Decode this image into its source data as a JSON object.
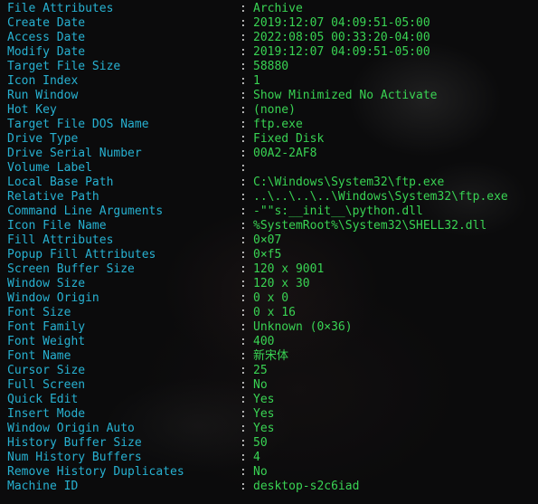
{
  "terminal": {
    "separator": ":",
    "rows": [
      {
        "key": "File Attributes",
        "value": "Archive"
      },
      {
        "key": "Create Date",
        "value": "2019:12:07 04:09:51-05:00"
      },
      {
        "key": "Access Date",
        "value": "2022:08:05 00:33:20-04:00"
      },
      {
        "key": "Modify Date",
        "value": "2019:12:07 04:09:51-05:00"
      },
      {
        "key": "Target File Size",
        "value": "58880"
      },
      {
        "key": "Icon Index",
        "value": "1"
      },
      {
        "key": "Run Window",
        "value": "Show Minimized No Activate"
      },
      {
        "key": "Hot Key",
        "value": "(none)"
      },
      {
        "key": "Target File DOS Name",
        "value": "ftp.exe"
      },
      {
        "key": "Drive Type",
        "value": "Fixed Disk"
      },
      {
        "key": "Drive Serial Number",
        "value": "00A2-2AF8"
      },
      {
        "key": "Volume Label",
        "value": ""
      },
      {
        "key": "Local Base Path",
        "value": "C:\\Windows\\System32\\ftp.exe"
      },
      {
        "key": "Relative Path",
        "value": "..\\..\\..\\..\\Windows\\System32\\ftp.exe"
      },
      {
        "key": "Command Line Arguments",
        "value": "-\"\"s:__init__\\python.dll"
      },
      {
        "key": "Icon File Name",
        "value": "%SystemRoot%\\System32\\SHELL32.dll"
      },
      {
        "key": "Fill Attributes",
        "value": "0×07"
      },
      {
        "key": "Popup Fill Attributes",
        "value": "0×f5"
      },
      {
        "key": "Screen Buffer Size",
        "value": "120 x 9001"
      },
      {
        "key": "Window Size",
        "value": "120 x 30"
      },
      {
        "key": "Window Origin",
        "value": "0 x 0"
      },
      {
        "key": "Font Size",
        "value": "0 x 16"
      },
      {
        "key": "Font Family",
        "value": "Unknown (0×36)"
      },
      {
        "key": "Font Weight",
        "value": "400"
      },
      {
        "key": "Font Name",
        "value": "新宋体"
      },
      {
        "key": "Cursor Size",
        "value": "25"
      },
      {
        "key": "Full Screen",
        "value": "No"
      },
      {
        "key": "Quick Edit",
        "value": "Yes"
      },
      {
        "key": "Insert Mode",
        "value": "Yes"
      },
      {
        "key": "Window Origin Auto",
        "value": "Yes"
      },
      {
        "key": "History Buffer Size",
        "value": "50"
      },
      {
        "key": "Num History Buffers",
        "value": "4"
      },
      {
        "key": "Remove History Duplicates",
        "value": "No"
      },
      {
        "key": "Machine ID",
        "value": "desktop-s2c6iad"
      }
    ]
  },
  "colors": {
    "background": "#0b0b0c",
    "key": "#27b1d1",
    "separator": "#d8d8d8",
    "value": "#39d353"
  }
}
